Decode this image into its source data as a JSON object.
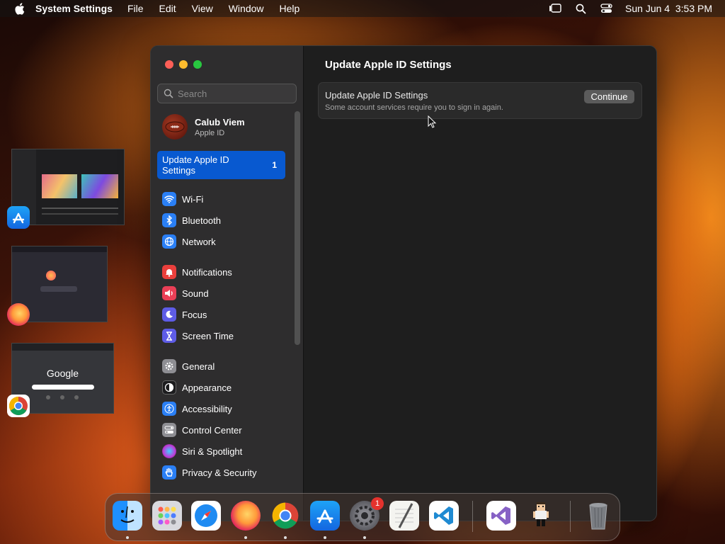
{
  "menubar": {
    "app_name": "System Settings",
    "menus": [
      "File",
      "Edit",
      "View",
      "Window",
      "Help"
    ],
    "datetime": "Sun Jun 4  3:53 PM"
  },
  "window": {
    "search": {
      "placeholder": "Search"
    },
    "profile": {
      "name": "Calub Viem",
      "subtitle": "Apple ID"
    },
    "selected_item": {
      "label": "Update Apple ID Settings",
      "count": "1"
    },
    "sidebar_items": [
      {
        "label": "Wi-Fi",
        "icon": "wifi-icon",
        "color": "#2a7ff5"
      },
      {
        "label": "Bluetooth",
        "icon": "bluetooth-icon",
        "color": "#2a7ff5"
      },
      {
        "label": "Network",
        "icon": "globe-icon",
        "color": "#2a7ff5"
      },
      {
        "label": "Notifications",
        "icon": "bell-icon",
        "color": "#ea3f3c"
      },
      {
        "label": "Sound",
        "icon": "speaker-icon",
        "color": "#ea3f56"
      },
      {
        "label": "Focus",
        "icon": "moon-icon",
        "color": "#5e5ce6"
      },
      {
        "label": "Screen Time",
        "icon": "hourglass-icon",
        "color": "#5e5ce6"
      },
      {
        "label": "General",
        "icon": "gear-icon",
        "color": "#8e8e93"
      },
      {
        "label": "Appearance",
        "icon": "appearance-icon",
        "color": "#1c1c1e"
      },
      {
        "label": "Accessibility",
        "icon": "accessibility-icon",
        "color": "#2a7ff5"
      },
      {
        "label": "Control Center",
        "icon": "toggles-icon",
        "color": "#8e8e93"
      },
      {
        "label": "Siri & Spotlight",
        "icon": "siri-icon",
        "color": "#c03ad8"
      },
      {
        "label": "Privacy & Security",
        "icon": "hand-icon",
        "color": "#2a7ff5"
      }
    ],
    "content": {
      "title": "Update Apple ID Settings",
      "card_title": "Update Apple ID Settings",
      "card_subtitle": "Some account services require you to sign in again.",
      "button_label": "Continue"
    }
  },
  "stage_thumbnails": {
    "google_label": "Google"
  },
  "dock": {
    "system_settings_badge": "1"
  }
}
